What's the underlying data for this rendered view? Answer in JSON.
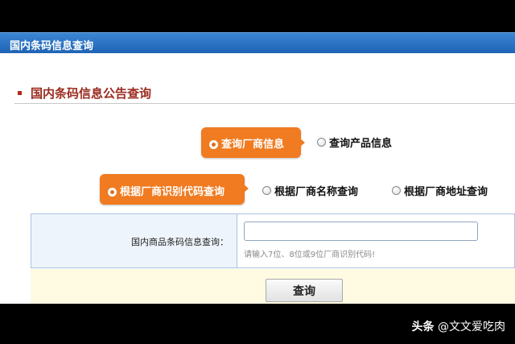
{
  "window": {
    "title": "国内条码信息查询"
  },
  "section": {
    "heading": "国内条码信息公告查询"
  },
  "query_type": {
    "company_label": "查询厂商信息",
    "product_label": "查询产品信息",
    "selected": "company"
  },
  "query_by": {
    "code_label": "根据厂商识别代码查询",
    "name_label": "根据厂商名称查询",
    "address_label": "根据厂商地址查询",
    "selected": "code"
  },
  "form": {
    "field_label": "国内商品条码信息查询：",
    "input_value": "",
    "hint": "请输入7位、8位或9位厂商识别代码!"
  },
  "buttons": {
    "query_label": "查询"
  },
  "watermark": {
    "brand": "头条",
    "handle": "@文文爱吃肉"
  },
  "colors": {
    "titlebar": "#1f63b4",
    "accent": "#f07b21",
    "heading": "#9b2b1f"
  }
}
